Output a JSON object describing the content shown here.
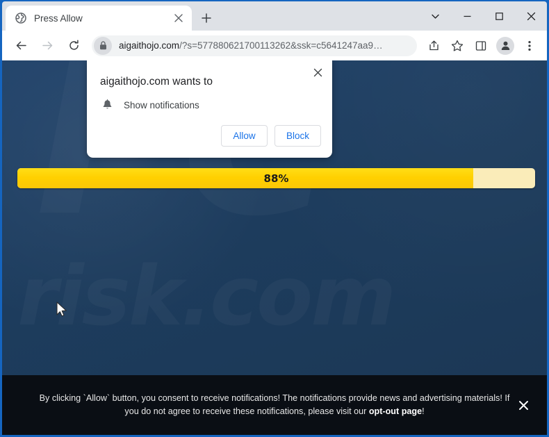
{
  "browser": {
    "tab": {
      "favicon": "globe-icon",
      "title": "Press Allow",
      "close_label": "×"
    },
    "new_tab_label": "+",
    "window_controls": {
      "tab_search": "tab-search-chevron-icon",
      "minimize": "—",
      "maximize": "□",
      "close": "✕"
    },
    "toolbar": {
      "back": "back-arrow-icon",
      "forward": "forward-arrow-icon",
      "reload": "reload-icon",
      "lock": "lock-icon",
      "url_domain": "aigaithojo.com",
      "url_path": "/?s=577880621700113262&ssk=c5641247aa9…",
      "share": "share-icon",
      "bookmark": "star-icon",
      "side_panel": "side-panel-icon",
      "profile": "profile-avatar-icon",
      "menu": "three-dot-menu-icon"
    }
  },
  "permission_dialog": {
    "title": "aigaithojo.com wants to",
    "permission_icon": "bell-icon",
    "permission_label": "Show notifications",
    "allow_label": "Allow",
    "block_label": "Block",
    "close_label": "✕"
  },
  "page": {
    "background_color": "#1E3D5E",
    "watermark_top": "PC",
    "watermark_bottom": "risk.com",
    "progress": {
      "percent_label": "88%",
      "percent_value": 88,
      "fill_color": "#FFD000",
      "track_color": "#FAECB9"
    },
    "cursor": "mouse-pointer-icon"
  },
  "consent_banner": {
    "text_before": "By clicking `Allow` button, you consent to receive notifications! The notifications provide news and advertising materials! If you do not agree to receive these notifications, please visit our ",
    "link_text": "opt-out page",
    "text_after": "!",
    "close_label": "✕",
    "background_color": "#0A0E14"
  }
}
